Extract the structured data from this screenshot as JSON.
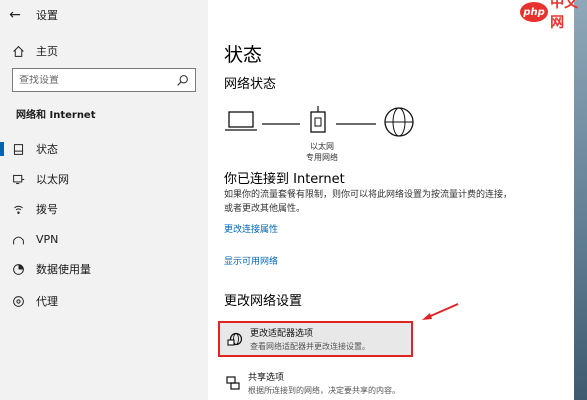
{
  "window": {
    "title": "设置"
  },
  "sidebar": {
    "home": "主页",
    "search_placeholder": "查找设置",
    "section": "网络和 Internet",
    "items": [
      {
        "label": "状态",
        "icon": "status-icon"
      },
      {
        "label": "以太网",
        "icon": "ethernet-icon"
      },
      {
        "label": "拨号",
        "icon": "dialup-icon"
      },
      {
        "label": "VPN",
        "icon": "vpn-icon"
      },
      {
        "label": "数据使用量",
        "icon": "data-usage-icon"
      },
      {
        "label": "代理",
        "icon": "proxy-icon"
      }
    ]
  },
  "main": {
    "heading": "状态",
    "network_status": "网络状态",
    "diagram": {
      "adapter_label": "以太网",
      "network_label": "专用网络"
    },
    "connected_heading": "你已连接到 Internet",
    "connected_desc": "如果你的流量套餐有限制，则你可以将此网络设置为按流量计费的连接，或者更改其他属性。",
    "link_change_props": "更改连接属性",
    "link_show_networks": "显示可用网络",
    "change_settings_heading": "更改网络设置",
    "options": [
      {
        "title": "更改适配器选项",
        "subtitle": "查看网络适配器并更改连接设置。"
      },
      {
        "title": "共享选项",
        "subtitle": "根据所连接到的网络，决定要共享的内容。"
      }
    ]
  },
  "watermark": {
    "brand": "php",
    "text": "中文网"
  },
  "colors": {
    "accent": "#0063b1",
    "link": "#0067b8",
    "highlight_border": "#e02424"
  }
}
